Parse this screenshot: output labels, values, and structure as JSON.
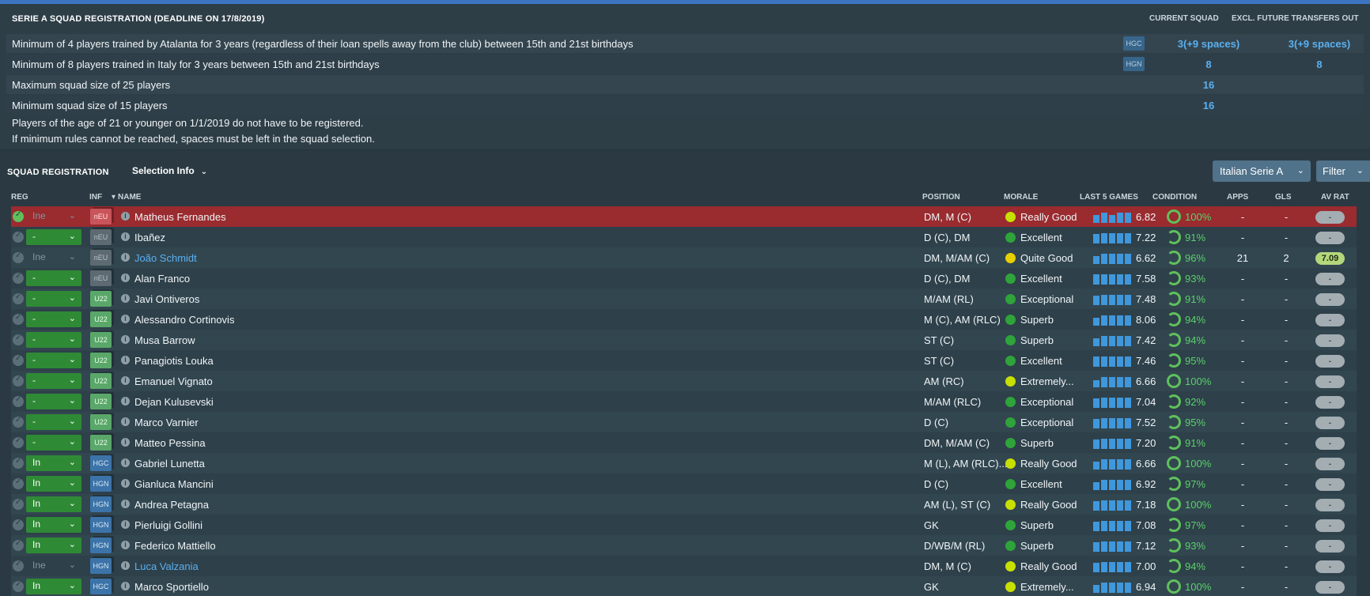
{
  "rules": {
    "title": "SERIE A SQUAD REGISTRATION (DEADLINE ON 17/8/2019)",
    "col_current": "CURRENT SQUAD",
    "col_excl": "EXCL. FUTURE TRANSFERS OUT",
    "items": [
      {
        "text": "Minimum of 4 players trained by Atalanta for 3 years (regardless of their loan spells away from the club) between 15th and 21st birthdays",
        "badge": "HGC",
        "current": "3(+9 spaces)",
        "excl": "3(+9 spaces)"
      },
      {
        "text": "Minimum of 8 players trained in Italy for 3 years between 15th and 21st birthdays",
        "badge": "HGN",
        "current": "8",
        "excl": "8"
      },
      {
        "text": "Maximum squad size of 25 players",
        "badge": "",
        "current": "16",
        "excl": ""
      },
      {
        "text": "Minimum squad size of 15 players",
        "badge": "",
        "current": "16",
        "excl": ""
      }
    ],
    "note1": "Players of the age of 21 or younger on 1/1/2019 do not have to be registered.",
    "note2": "If minimum rules cannot be reached, spaces must be left in the squad selection."
  },
  "squad": {
    "title": "SQUAD REGISTRATION",
    "selection_info": "Selection Info",
    "league": "Italian Serie A",
    "filter": "Filter",
    "headers": {
      "reg": "REG",
      "inf": "INF",
      "name": "NAME",
      "position": "POSITION",
      "morale": "MORALE",
      "last5": "LAST 5 GAMES",
      "condition": "CONDITION",
      "apps": "APPS",
      "gls": "GLS",
      "avrat": "AV RAT"
    },
    "players": [
      {
        "reg": "Ine",
        "inf": "nEU",
        "name": "Matheus Fernandes",
        "pos": "DM, M (C)",
        "morale": "Really Good",
        "last": "6.82",
        "cond": "100%",
        "apps": "-",
        "gls": "-",
        "avr": "-"
      },
      {
        "reg": "-",
        "inf": "nEU",
        "name": "Ibañez",
        "pos": "D (C), DM",
        "morale": "Excellent",
        "last": "7.22",
        "cond": "91%",
        "apps": "-",
        "gls": "-",
        "avr": "-"
      },
      {
        "reg": "Ine",
        "inf": "nEU",
        "name": "João Schmidt",
        "pos": "DM, M/AM (C)",
        "morale": "Quite Good",
        "last": "6.62",
        "cond": "96%",
        "apps": "21",
        "gls": "2",
        "avr": "7.09"
      },
      {
        "reg": "-",
        "inf": "nEU",
        "name": "Alan Franco",
        "pos": "D (C), DM",
        "morale": "Excellent",
        "last": "7.58",
        "cond": "93%",
        "apps": "-",
        "gls": "-",
        "avr": "-"
      },
      {
        "reg": "-",
        "inf": "U22",
        "name": "Javi Ontiveros",
        "pos": "M/AM (RL)",
        "morale": "Exceptional",
        "last": "7.48",
        "cond": "91%",
        "apps": "-",
        "gls": "-",
        "avr": "-"
      },
      {
        "reg": "-",
        "inf": "U22",
        "name": "Alessandro Cortinovis",
        "pos": "M (C), AM (RLC)",
        "morale": "Superb",
        "last": "8.06",
        "cond": "94%",
        "apps": "-",
        "gls": "-",
        "avr": "-"
      },
      {
        "reg": "-",
        "inf": "U22",
        "name": "Musa Barrow",
        "pos": "ST (C)",
        "morale": "Superb",
        "last": "7.42",
        "cond": "94%",
        "apps": "-",
        "gls": "-",
        "avr": "-"
      },
      {
        "reg": "-",
        "inf": "U22",
        "name": "Panagiotis Louka",
        "pos": "ST (C)",
        "morale": "Excellent",
        "last": "7.46",
        "cond": "95%",
        "apps": "-",
        "gls": "-",
        "avr": "-"
      },
      {
        "reg": "-",
        "inf": "U22",
        "name": "Emanuel Vignato",
        "pos": "AM (RC)",
        "morale": "Extremely...",
        "last": "6.66",
        "cond": "100%",
        "apps": "-",
        "gls": "-",
        "avr": "-"
      },
      {
        "reg": "-",
        "inf": "U22",
        "name": "Dejan Kulusevski",
        "pos": "M/AM (RLC)",
        "morale": "Exceptional",
        "last": "7.04",
        "cond": "92%",
        "apps": "-",
        "gls": "-",
        "avr": "-"
      },
      {
        "reg": "-",
        "inf": "U22",
        "name": "Marco Varnier",
        "pos": "D (C)",
        "morale": "Exceptional",
        "last": "7.52",
        "cond": "95%",
        "apps": "-",
        "gls": "-",
        "avr": "-"
      },
      {
        "reg": "-",
        "inf": "U22",
        "name": "Matteo Pessina",
        "pos": "DM, M/AM (C)",
        "morale": "Superb",
        "last": "7.20",
        "cond": "91%",
        "apps": "-",
        "gls": "-",
        "avr": "-"
      },
      {
        "reg": "In",
        "inf": "HGC",
        "name": "Gabriel Lunetta",
        "pos": "M (L), AM (RLC)...",
        "morale": "Really Good",
        "last": "6.66",
        "cond": "100%",
        "apps": "-",
        "gls": "-",
        "avr": "-"
      },
      {
        "reg": "In",
        "inf": "HGN",
        "name": "Gianluca Mancini",
        "pos": "D (C)",
        "morale": "Excellent",
        "last": "6.92",
        "cond": "97%",
        "apps": "-",
        "gls": "-",
        "avr": "-"
      },
      {
        "reg": "In",
        "inf": "HGN",
        "name": "Andrea Petagna",
        "pos": "AM (L), ST (C)",
        "morale": "Really Good",
        "last": "7.18",
        "cond": "100%",
        "apps": "-",
        "gls": "-",
        "avr": "-"
      },
      {
        "reg": "In",
        "inf": "HGN",
        "name": "Pierluigi Gollini",
        "pos": "GK",
        "morale": "Superb",
        "last": "7.08",
        "cond": "97%",
        "apps": "-",
        "gls": "-",
        "avr": "-"
      },
      {
        "reg": "In",
        "inf": "HGN",
        "name": "Federico Mattiello",
        "pos": "D/WB/M (RL)",
        "morale": "Superb",
        "last": "7.12",
        "cond": "93%",
        "apps": "-",
        "gls": "-",
        "avr": "-"
      },
      {
        "reg": "Ine",
        "inf": "HGN",
        "name": "Luca Valzania",
        "pos": "DM, M (C)",
        "morale": "Really Good",
        "last": "7.00",
        "cond": "94%",
        "apps": "-",
        "gls": "-",
        "avr": "-"
      },
      {
        "reg": "In",
        "inf": "HGC",
        "name": "Marco Sportiello",
        "pos": "GK",
        "morale": "Extremely...",
        "last": "6.94",
        "cond": "100%",
        "apps": "-",
        "gls": "-",
        "avr": "-"
      }
    ]
  }
}
